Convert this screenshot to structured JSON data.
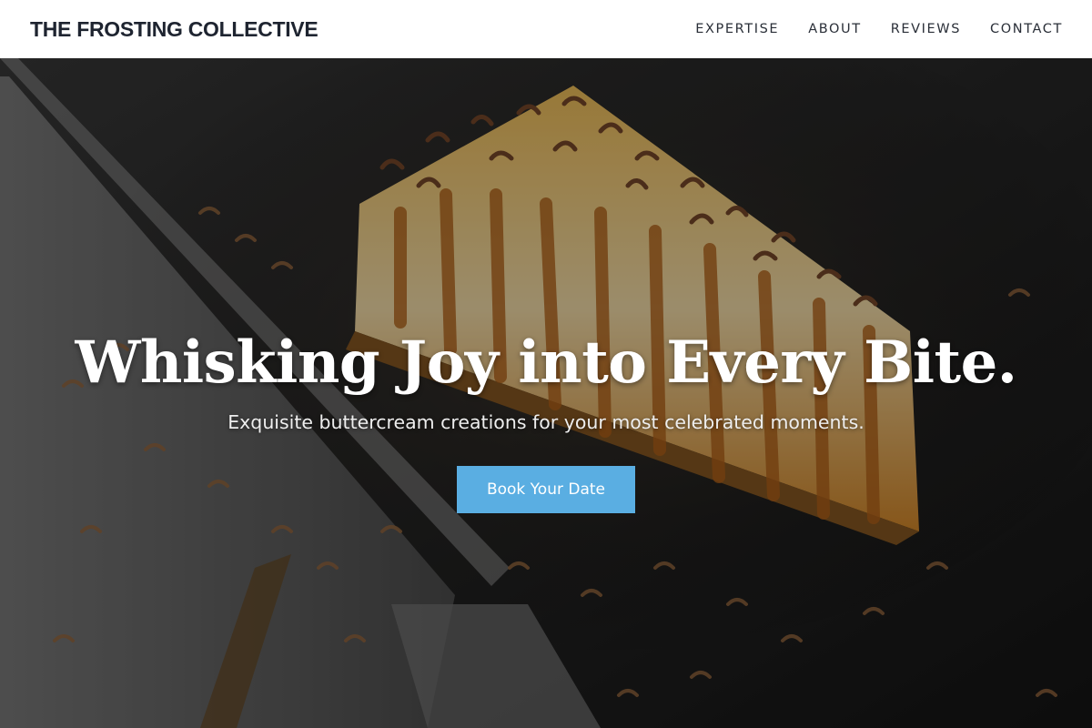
{
  "header": {
    "brand": "THE FROSTING COLLECTIVE",
    "nav": [
      "EXPERTISE",
      "ABOUT",
      "REVIEWS",
      "CONTACT"
    ]
  },
  "hero": {
    "headline": "Whisking Joy into Every Bite.",
    "subheadline": "Exquisite buttercream creations for your most celebrated moments.",
    "cta_label": "Book Your Date",
    "background_image": "cheesecake-with-chocolate-shavings",
    "colors": {
      "cta": "#5aaee2",
      "overlay": "#000000",
      "header_bg": "#ffffff",
      "brand_text": "#1e2430"
    }
  }
}
